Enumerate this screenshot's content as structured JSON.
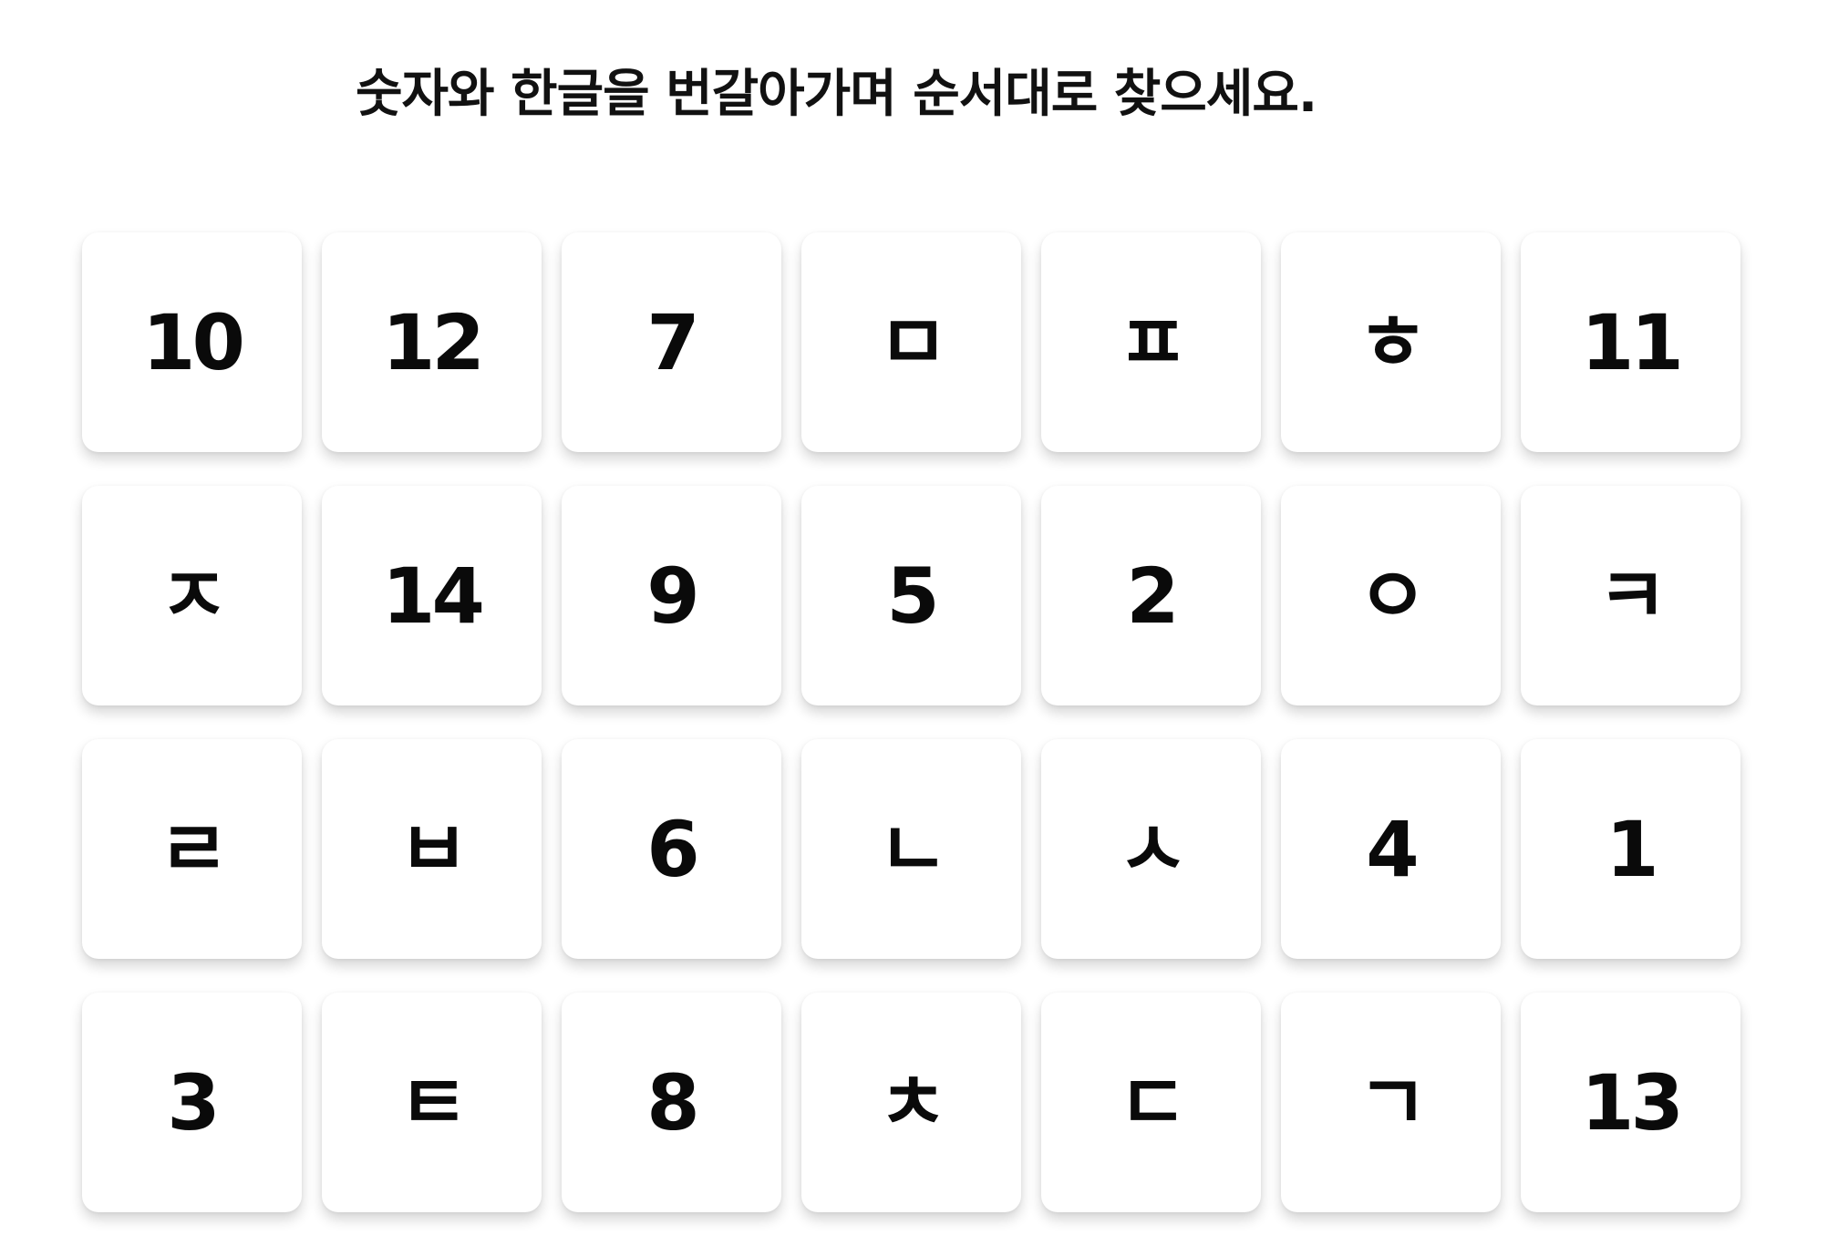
{
  "instruction": "숫자와 한글을 번갈아가며 순서대로 찾으세요.",
  "tiles": [
    "10",
    "12",
    "7",
    "ㅁ",
    "ㅍ",
    "ㅎ",
    "11",
    "ㅈ",
    "14",
    "9",
    "5",
    "2",
    "ㅇ",
    "ㅋ",
    "ㄹ",
    "ㅂ",
    "6",
    "ㄴ",
    "ㅅ",
    "4",
    "1",
    "3",
    "ㅌ",
    "8",
    "ㅊ",
    "ㄷ",
    "ㄱ",
    "13"
  ]
}
